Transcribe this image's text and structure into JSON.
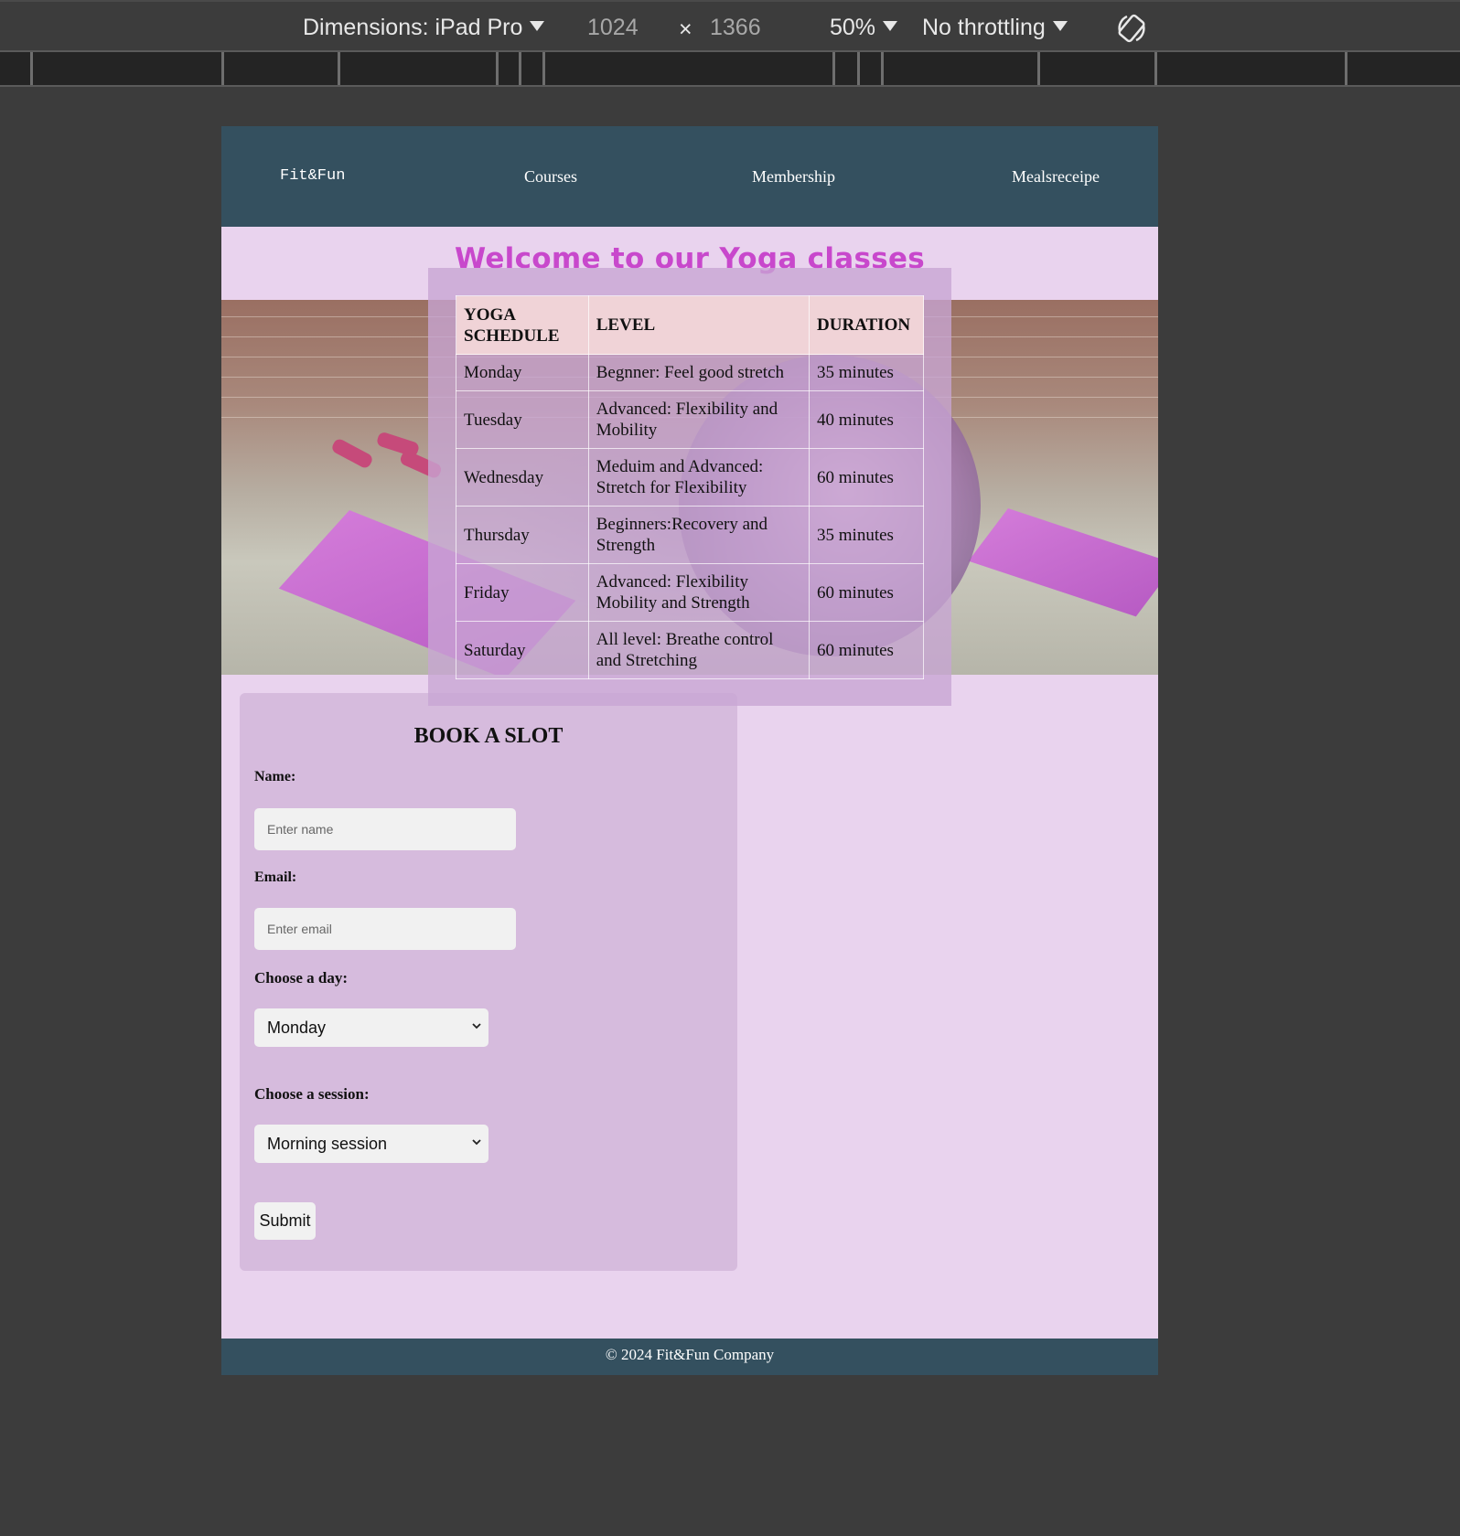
{
  "devtools": {
    "device_label": "Dimensions: iPad Pro",
    "width_value": "1024",
    "times_symbol": "×",
    "height_value": "1366",
    "zoom": "50%",
    "throttling": "No throttling",
    "rotate_icon": "rotate-icon"
  },
  "nav": {
    "logo": "Fit&Fun",
    "items": [
      "Courses",
      "Membership",
      "Mealsreceipe"
    ]
  },
  "welcome_title": "Welcome to our Yoga classes",
  "schedule": {
    "headers": [
      "YOGA SCHEDULE",
      "LEVEL",
      "DURATION"
    ],
    "rows": [
      {
        "day": "Monday",
        "level": "Begnner: Feel good stretch",
        "duration": "35 minutes"
      },
      {
        "day": "Tuesday",
        "level": "Advanced: Flexibility and Mobility",
        "duration": "40 minutes"
      },
      {
        "day": "Wednesday",
        "level": "Meduim and Advanced: Stretch for Flexibility",
        "duration": "60 minutes"
      },
      {
        "day": "Thursday",
        "level": "Beginners:Recovery and Strength",
        "duration": "35 minutes"
      },
      {
        "day": "Friday",
        "level": "Advanced: Flexibility Mobility and Strength",
        "duration": "60 minutes"
      },
      {
        "day": "Saturday",
        "level": "All level: Breathe control and Stretching",
        "duration": "60 minutes"
      }
    ]
  },
  "booking": {
    "title": "BOOK A SLOT",
    "name_label": "Name:",
    "name_placeholder": "Enter name",
    "email_label": "Email:",
    "email_placeholder": "Enter email",
    "day_label": "Choose a day:",
    "day_value": "Monday",
    "session_label": "Choose a session:",
    "session_value": "Morning session",
    "submit_label": "Submit"
  },
  "footer_text": "© 2024 Fit&Fun Company",
  "colors": {
    "nav_bg": "#34505f",
    "page_bg": "#e9d3ee",
    "title_color": "#c848cc",
    "booking_bg": "#d6bbdd",
    "devtools_bg": "#3c3c3c"
  }
}
